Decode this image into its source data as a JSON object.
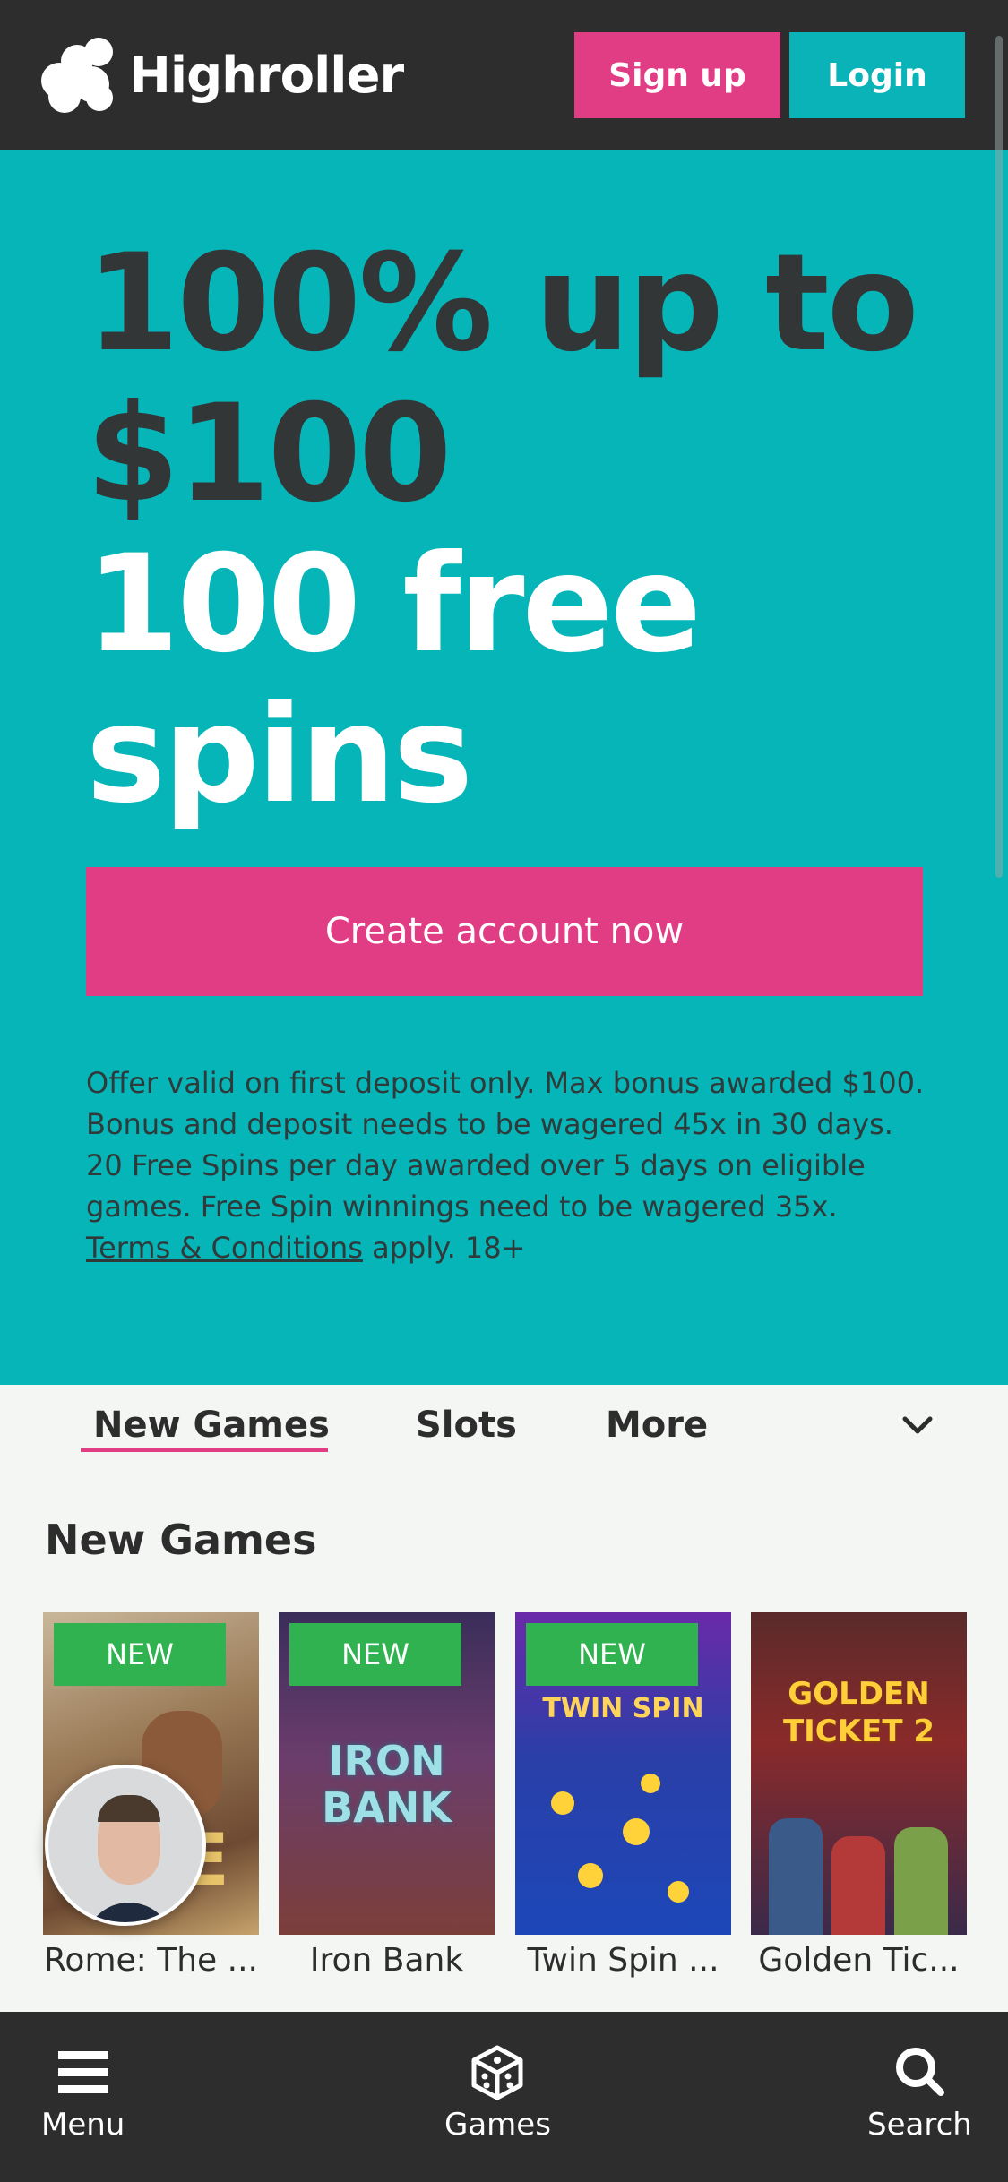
{
  "header": {
    "brand": "Highroller",
    "signup_label": "Sign up",
    "login_label": "Login"
  },
  "hero": {
    "line1": "100% up to",
    "line2": "$100",
    "line3": "100 free",
    "line4": "spins",
    "cta_label": "Create account now",
    "terms_text": "Offer valid on first deposit only. Max bonus awarded $100. Bonus and deposit needs to be wagered 45x in 30 days. 20 Free Spins per day awarded over 5 days on eligible games. Free Spin winnings need to be wagered 35x.",
    "terms_link": "Terms & Conditions",
    "terms_suffix": " apply. 18+"
  },
  "tabs": [
    {
      "label": "New Games"
    },
    {
      "label": "Slots"
    },
    {
      "label": "More"
    }
  ],
  "section": {
    "title": "New Games"
  },
  "games": [
    {
      "title": "Rome: The ...",
      "badge": "NEW",
      "art_text": "E"
    },
    {
      "title": "Iron Bank",
      "badge": "NEW",
      "art_text": "IRON BANK"
    },
    {
      "title": "Twin Spin ...",
      "badge": "NEW",
      "art_text": "TWIN SPIN"
    },
    {
      "title": "Golden Tic...",
      "badge": "",
      "art_text": "GOLDEN TICKET 2"
    }
  ],
  "bottom_nav": {
    "menu_label": "Menu",
    "games_label": "Games",
    "search_label": "Search"
  },
  "colors": {
    "brand_teal": "#06b5b8",
    "brand_pink": "#e03d84",
    "header_bg": "#2d2d2d",
    "badge_green": "#2fb24f"
  },
  "icons": [
    "logo-icon",
    "chevron-down-icon",
    "menu-icon",
    "dice-icon",
    "search-icon"
  ]
}
